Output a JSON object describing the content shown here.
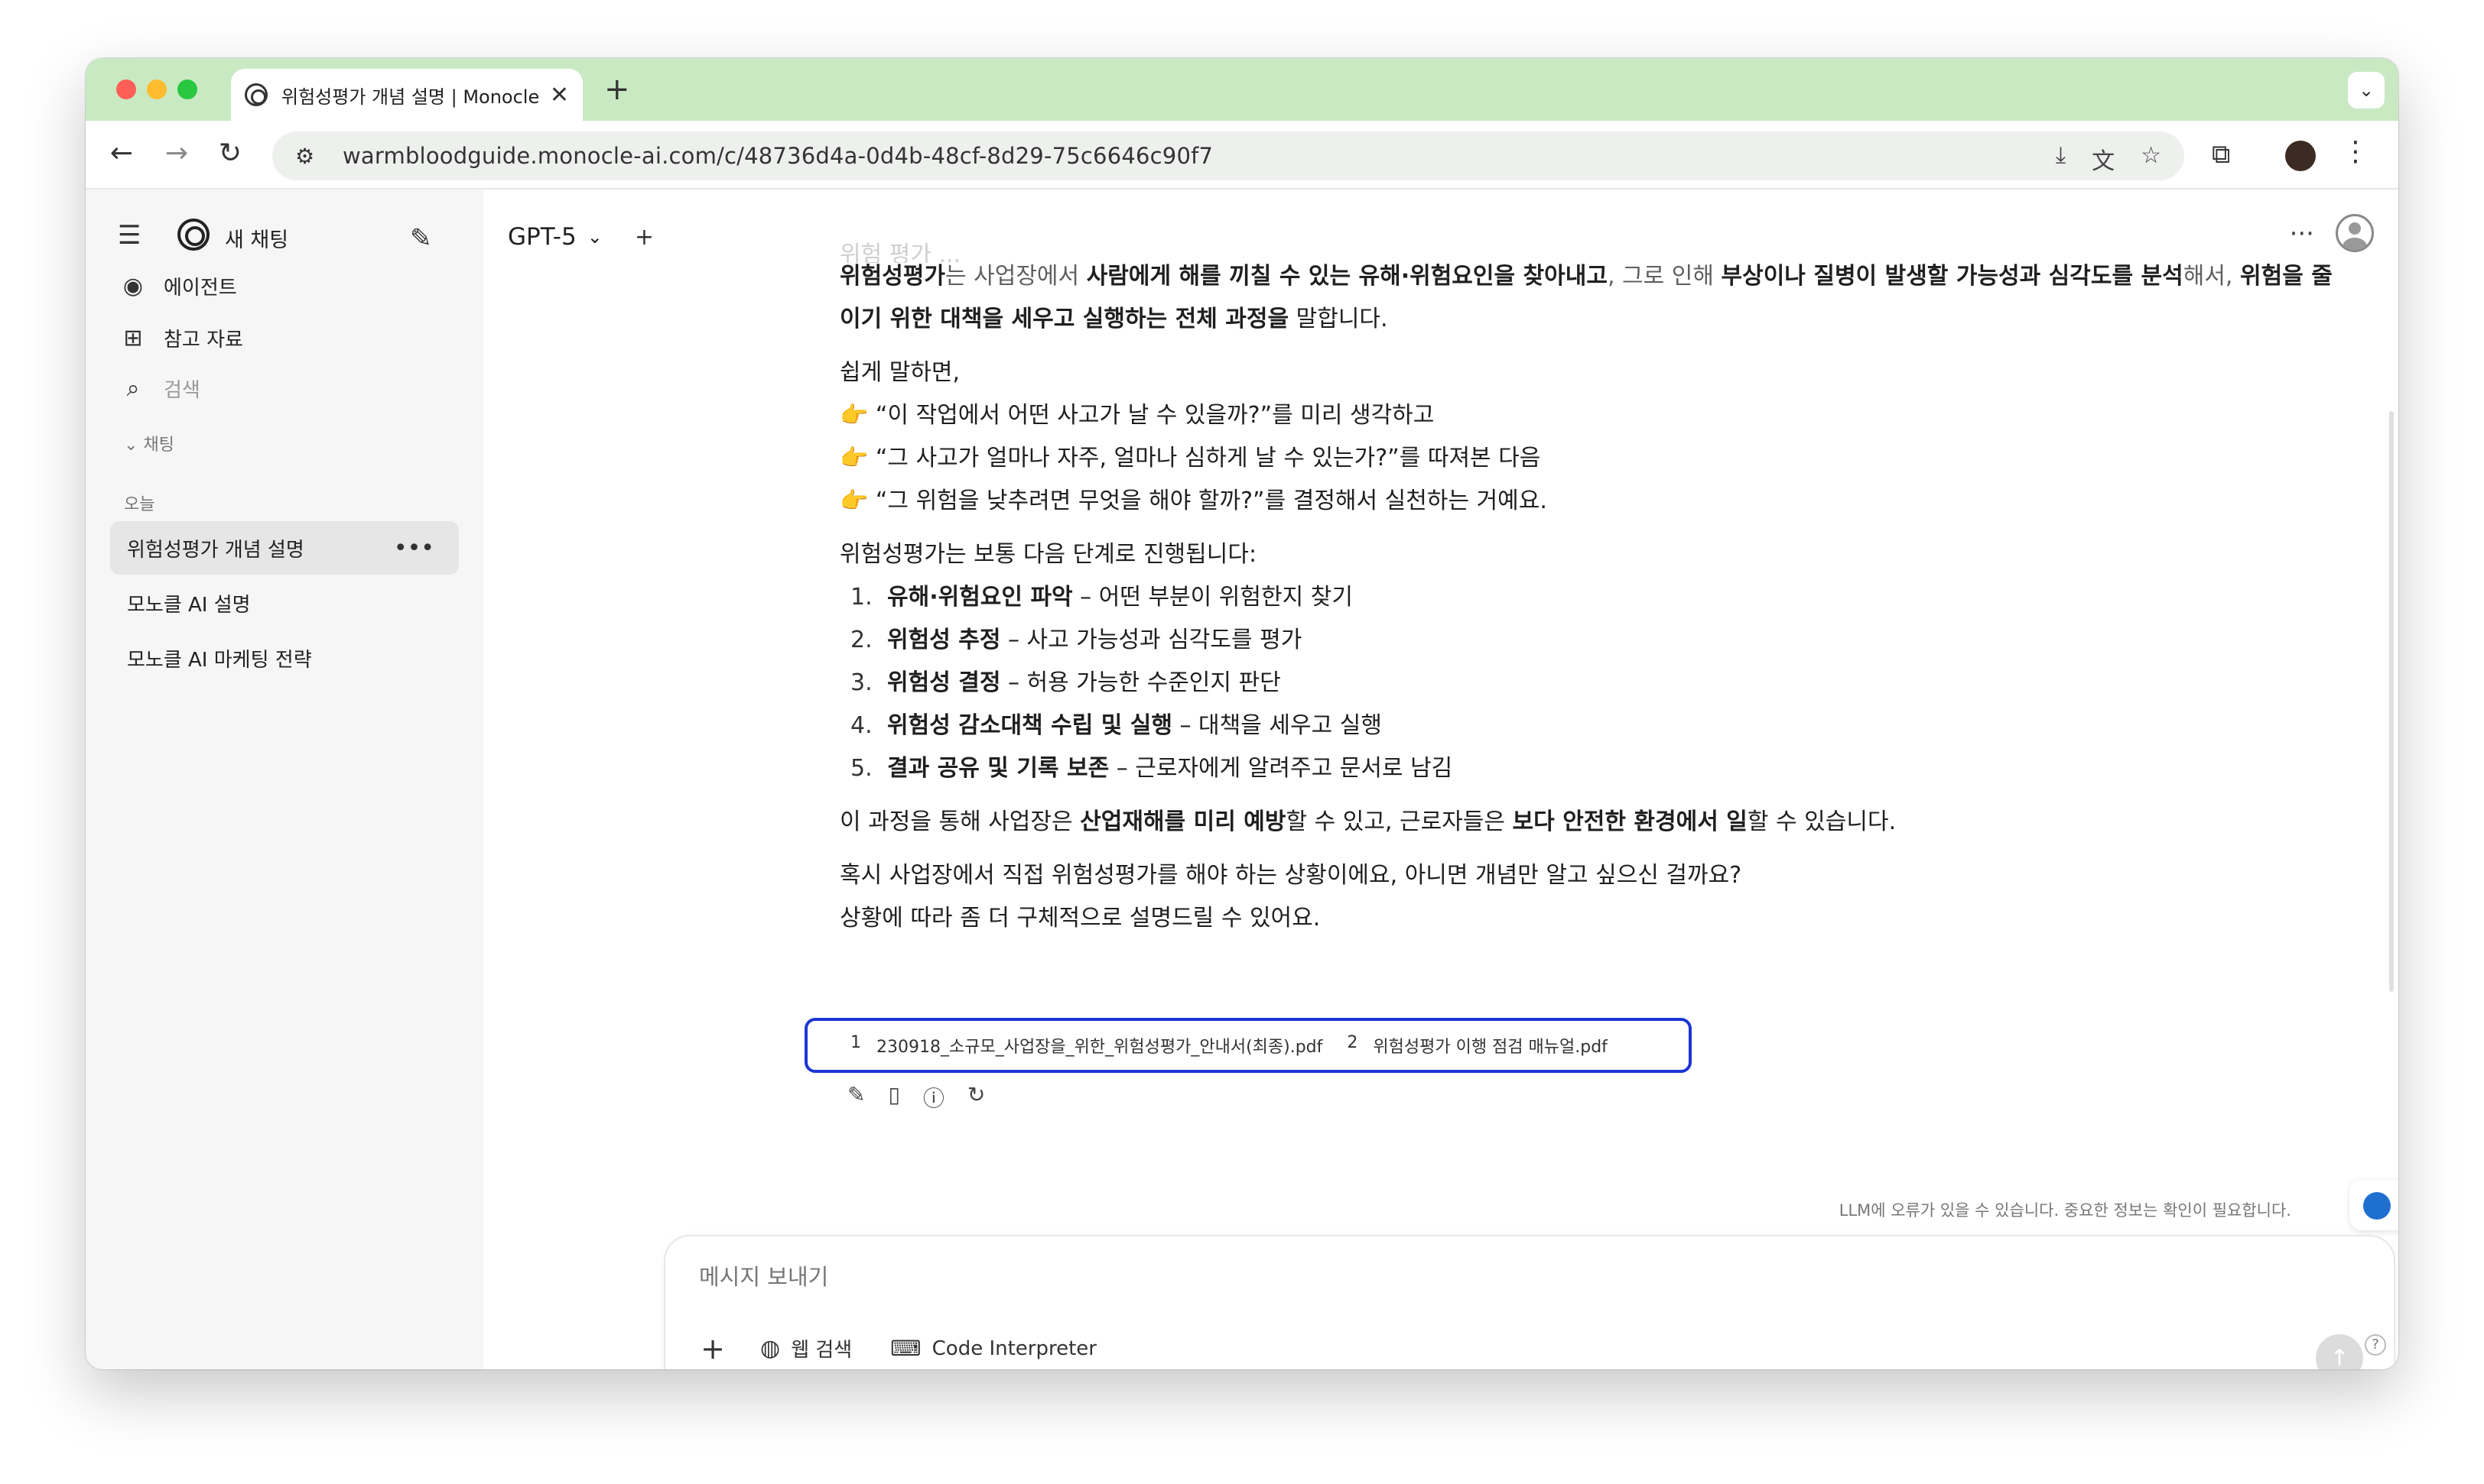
{
  "browser": {
    "tab_title": "위험성평가 개념 설명 | Monocle AI",
    "url": "warmbloodguide.monocle-ai.com/c/48736d4a-0d4b-48cf-8d29-75c6646c90f7"
  },
  "sidebar": {
    "new_chat": "새 채팅",
    "items": [
      {
        "label": "에이전트"
      },
      {
        "label": "참고 자료"
      },
      {
        "label": "검색"
      }
    ],
    "section_chats": "채팅",
    "section_today": "오늘",
    "chats": [
      {
        "label": "위험성평가 개념 설명"
      },
      {
        "label": "모노클 AI 설명"
      },
      {
        "label": "모노클 AI 마케팅 전략"
      }
    ]
  },
  "main": {
    "model": "GPT-5"
  },
  "message": {
    "faded_prev": "위험 평가 ...",
    "p1": {
      "a": "위험성평가",
      "b": "는 사업장에서 ",
      "c": "사람에게 해를 끼칠 수 있는 유해·위험요인을 찾아내고",
      "d": ", 그로 인해 ",
      "e": "부상이나 질병이 발생할 가능성과 심각도를 분석",
      "f": "해서, ",
      "g": "위험을 줄이기 위한 대책을 세우고 실행하는 전체 과정을",
      "h": " 말합니다."
    },
    "p2_intro": "쉽게 말하면,",
    "bullets": [
      "“이 작업에서 어떤 사고가 날 수 있을까?”를 미리 생각하고",
      "“그 사고가 얼마나 자주, 얼마나 심하게 날 수 있는가?”를 따져본 다음",
      "“그 위험을 낮추려면 무엇을 해야 할까?”를 결정해서 실천하는 거예요."
    ],
    "steps_intro": "위험성평가는 보통 다음 단계로 진행됩니다:",
    "steps": [
      {
        "num": "1.",
        "bold": "유해·위험요인 파악",
        "rest": " – 어떤 부분이 위험한지 찾기"
      },
      {
        "num": "2.",
        "bold": "위험성 추정",
        "rest": " – 사고 가능성과 심각도를 평가"
      },
      {
        "num": "3.",
        "bold": "위험성 결정",
        "rest": " – 허용 가능한 수준인지 판단"
      },
      {
        "num": "4.",
        "bold": "위험성 감소대책 수립 및 실행",
        "rest": " – 대책을 세우고 실행"
      },
      {
        "num": "5.",
        "bold": "결과 공유 및 기록 보존",
        "rest": " – 근로자에게 알려주고 문서로 남김"
      }
    ],
    "p4": {
      "a": "이 과정을 통해 사업장은 ",
      "b": "산업재해를 미리 예방",
      "c": "할 수 있고, 근로자들은 ",
      "d": "보다 안전한 환경에서 일",
      "e": "할 수 있습니다."
    },
    "p5_1": "혹시 사업장에서 직접 위험성평가를 해야 하는 상황이에요, 아니면 개념만 알고 싶으신 걸까요?",
    "p5_2": "상황에 따라 좀 더 구체적으로 설명드릴 수 있어요.",
    "citations": [
      {
        "num": "1",
        "file": "230918_소규모_사업장을_위한_위험성평가_안내서(최종).pdf"
      },
      {
        "num": "2",
        "file": "위험성평가 이행 점검 매뉴얼.pdf"
      }
    ]
  },
  "disclaimer": "LLM에 오류가 있을 수 있습니다. 중요한 정보는 확인이 필요합니다.",
  "composer": {
    "placeholder": "메시지 보내기",
    "web_search": "웹 검색",
    "code_interpreter": "Code Interpreter"
  },
  "help": "?"
}
